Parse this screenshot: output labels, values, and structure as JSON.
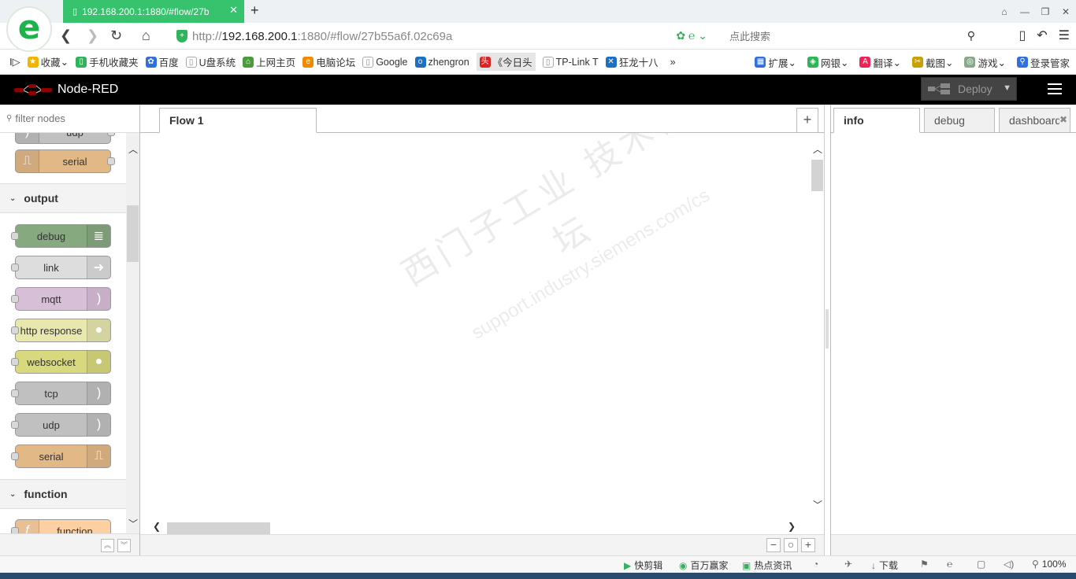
{
  "browser": {
    "tab_title": "192.168.200.1:1880/#flow/27b",
    "tab_close": "✕",
    "new_tab": "+",
    "url_host": "192.168.200.1",
    "url_prefix": "http://",
    "url_rest": ":1880/#flow/27b55a6f.02c69a",
    "search_placeholder": "点此搜索",
    "zoom": "100%"
  },
  "bookmarks": [
    {
      "label": "收藏",
      "color": "#f2b400"
    },
    {
      "label": "手机收藏夹",
      "color": "#2fb45a"
    },
    {
      "label": "百度",
      "color": "#2f6fde"
    },
    {
      "label": "U盘系统",
      "color": "#aaaaaa"
    },
    {
      "label": "上网主页",
      "color": "#4a9b3a"
    },
    {
      "label": "电脑论坛",
      "color": "#f08a00"
    },
    {
      "label": "Google",
      "color": "#aaaaaa"
    },
    {
      "label": "zhengron",
      "color": "#1e6fc1"
    },
    {
      "label": "《今日头",
      "color": "#d22"
    },
    {
      "label": "TP-Link T",
      "color": "#aaaaaa"
    },
    {
      "label": "狂龙十八",
      "color": "#1e6fc1"
    }
  ],
  "bookmarks_more": "»",
  "bookmarks_right": [
    {
      "label": "扩展"
    },
    {
      "label": "网银"
    },
    {
      "label": "翻译"
    },
    {
      "label": "截图"
    },
    {
      "label": "游戏"
    },
    {
      "label": "登录管家"
    }
  ],
  "header": {
    "title": "Node-RED",
    "deploy_label": "Deploy"
  },
  "palette": {
    "filter_placeholder": "filter nodes",
    "top_partial_node": "udp",
    "top_node": {
      "label": "serial",
      "color": "#e2b887"
    },
    "category_output": "output",
    "output_nodes": [
      {
        "label": "debug",
        "color": "#87a980",
        "icon": "≣"
      },
      {
        "label": "link",
        "color": "#dddddd",
        "icon": "➜"
      },
      {
        "label": "mqtt",
        "color": "#d8bfd8",
        "icon": ")"
      },
      {
        "label": "http response",
        "color": "#e7e7ae",
        "icon": "●"
      },
      {
        "label": "websocket",
        "color": "#d8d87e",
        "icon": "●"
      },
      {
        "label": "tcp",
        "color": "#c0c0c0",
        "icon": ")"
      },
      {
        "label": "udp",
        "color": "#c0c0c0",
        "icon": ")"
      },
      {
        "label": "serial",
        "color": "#e2b887",
        "icon": "⎍"
      }
    ],
    "category_function": "function",
    "function_nodes": [
      {
        "label": "function",
        "color": "#fdd0a2",
        "icon": "f"
      }
    ]
  },
  "workspace": {
    "tab_label": "Flow 1",
    "add_tab": "+",
    "watermark_line1": "西门子工业 技术论坛",
    "watermark_line2": "support.industry.siemens.com/cs"
  },
  "sidebar": {
    "tabs": [
      {
        "label": "info"
      },
      {
        "label": "debug"
      },
      {
        "label": "dashboard"
      }
    ]
  },
  "status": {
    "items": [
      "快剪辑",
      "百万赢家",
      "热点资讯",
      "下载"
    ]
  }
}
